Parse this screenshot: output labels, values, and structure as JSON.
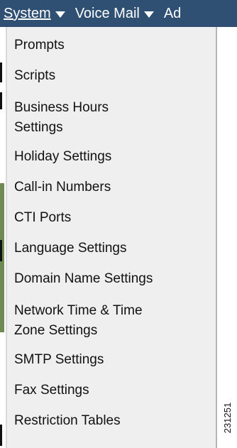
{
  "menubar": {
    "system_label": "System",
    "voicemail_label": "Voice Mail",
    "admin_label_partial": "Ad"
  },
  "dropdown": {
    "items": [
      {
        "label": "Prompts"
      },
      {
        "label": "Scripts"
      },
      {
        "label": "Business Hours Settings",
        "line1": "Business Hours",
        "line2": "Settings"
      },
      {
        "label": "Holiday Settings"
      },
      {
        "label": "Call-in Numbers"
      },
      {
        "label": "CTI Ports"
      },
      {
        "label": "Language Settings"
      },
      {
        "label": "Domain Name Settings"
      },
      {
        "label": "Network Time & Time Zone Settings",
        "line1": "Network Time & Time",
        "line2": "Zone Settings"
      },
      {
        "label": "SMTP Settings"
      },
      {
        "label": "Fax Settings"
      },
      {
        "label": "Restriction Tables"
      }
    ]
  },
  "figure_code": "231251",
  "colors": {
    "menubar_bg": "#2f4f73",
    "menu_text": "#ffffff",
    "dropdown_bg": "#efefef"
  }
}
